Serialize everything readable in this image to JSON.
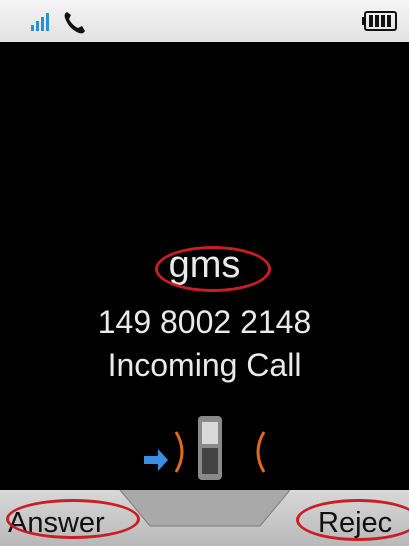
{
  "status_bar": {
    "icons": [
      "signal-icon",
      "phone-icon",
      "battery-icon"
    ]
  },
  "call": {
    "caller_name": "gms",
    "caller_number": "149 8002 2148",
    "status": "Incoming Call"
  },
  "softkeys": {
    "answer_label": "Answer",
    "reject_label": "Rejec"
  },
  "colors": {
    "highlight_ring": "#c81e24",
    "text": "#eaeaea",
    "background": "#000000",
    "signal": "#2a8fd6",
    "arrow": "#3a8fe0",
    "ringing_wave": "#e06a1c"
  }
}
